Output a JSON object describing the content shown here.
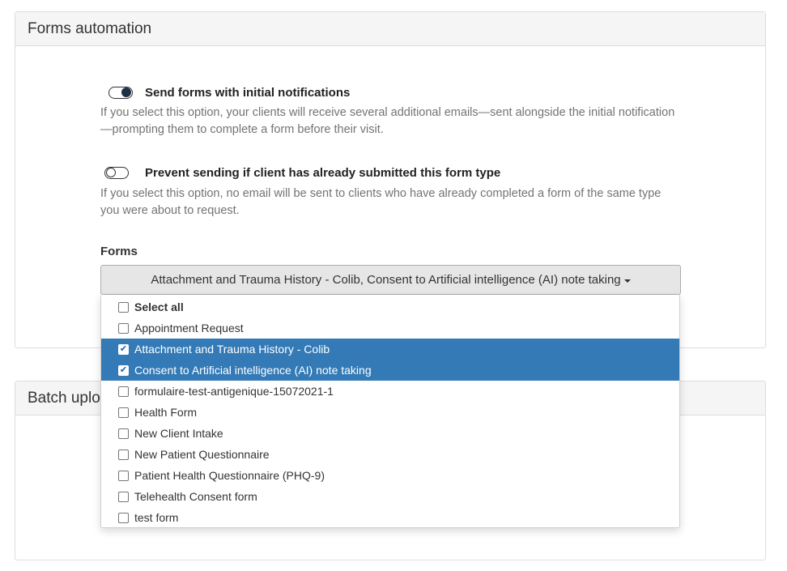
{
  "forms_automation": {
    "title": "Forms automation",
    "send_forms": {
      "label": "Send forms with initial notifications",
      "enabled": true,
      "help": "If you select this option, your clients will receive several additional emails—sent alongside the initial notification—prompting them to complete a form before their visit."
    },
    "prevent_sending": {
      "label": "Prevent sending if client has already submitted this form type",
      "enabled": false,
      "help": "If you select this option, no email will be sent to clients who have already completed a form of the same type you were about to request."
    },
    "forms_label": "Forms",
    "forms_select_value": "Attachment and Trauma History - Colib, Consent to Artificial intelligence (AI) note taking",
    "options": [
      {
        "label": "Select all",
        "checked": false,
        "bold": true
      },
      {
        "label": "Appointment Request",
        "checked": false
      },
      {
        "label": "Attachment and Trauma History - Colib",
        "checked": true
      },
      {
        "label": "Consent to Artificial intelligence (AI) note taking",
        "checked": true
      },
      {
        "label": "formulaire-test-antigenique-15072021-1",
        "checked": false
      },
      {
        "label": "Health Form",
        "checked": false
      },
      {
        "label": "New Client Intake",
        "checked": false
      },
      {
        "label": "New Patient Questionnaire",
        "checked": false
      },
      {
        "label": "Patient Health Questionnaire (PHQ-9)",
        "checked": false
      },
      {
        "label": "Telehealth Consent form",
        "checked": false
      },
      {
        "label": "test form",
        "checked": false
      }
    ]
  },
  "batch_upload": {
    "title_visible": "Batch uplo"
  },
  "colors": {
    "selected_row": "#337ab7",
    "panel_heading_bg": "#f5f5f5",
    "toggle_knob": "#1f2f45"
  }
}
